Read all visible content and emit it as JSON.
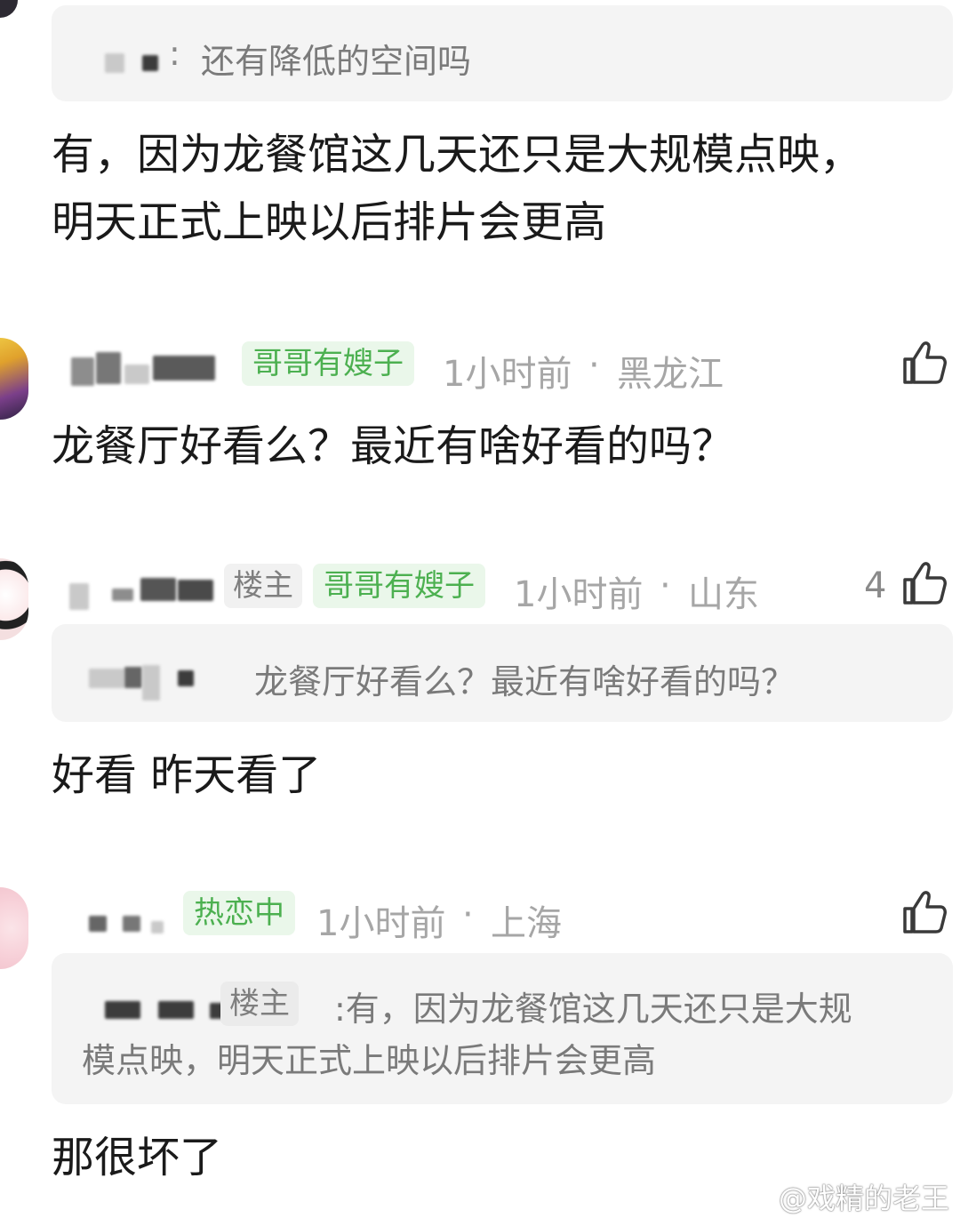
{
  "top_reply": {
    "quote_text": "还有降低的空间吗",
    "body_lines": [
      "有，因为龙餐馆这几天还只是大规模点映，",
      "明天正式上映以后排片会更高"
    ]
  },
  "comment_1": {
    "badge": "哥哥有嫂子",
    "time": "1小时前",
    "location": "黑龙江",
    "body": "龙餐厅好看么？最近有啥好看的吗？"
  },
  "comment_2": {
    "op_tag": "楼主",
    "badge": "哥哥有嫂子",
    "time": "1小时前",
    "location": "山东",
    "like_count": "4",
    "quote_text": "龙餐厅好看么？最近有啥好看的吗？",
    "body": "好看 昨天看了"
  },
  "comment_3": {
    "badge": "热恋中",
    "time": "1小时前",
    "location": "上海",
    "op_tag": "楼主",
    "quote_line1": ":有，因为龙餐馆这几天还只是大规",
    "quote_line2": "模点映，明天正式上映以后排片会更高",
    "body": "那很坏了"
  },
  "separator": "·",
  "watermark": "@戏精的老王",
  "colors": {
    "badge_green": "#4cb050",
    "badge_green_bg": "#eaf7ea",
    "meta_gray": "#a6a6a6",
    "quote_bg": "#f4f4f4"
  },
  "icons": {
    "like": "thumbs-up-icon",
    "weibo": "weibo-logo-icon"
  }
}
